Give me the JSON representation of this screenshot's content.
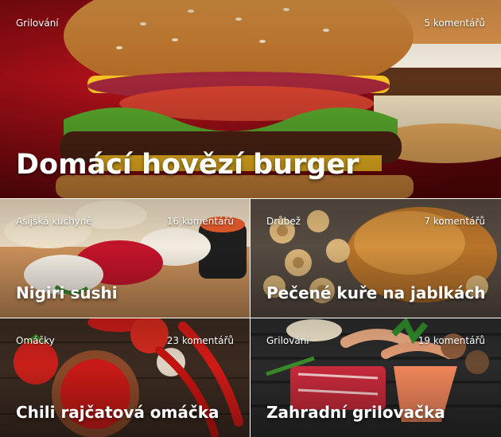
{
  "featured": {
    "category": "Grilování",
    "comments": "5 komentářů",
    "title": "Domácí hovězí burger"
  },
  "articles": [
    {
      "category": "Asijská kuchyně",
      "comments": "16 komentářů",
      "title": "Nigiri sushi"
    },
    {
      "category": "Drůbež",
      "comments": "7 komentářů",
      "title": "Pečené kuře na jablkách"
    },
    {
      "category": "Omáčky",
      "comments": "23 komentářů",
      "title": "Chili rajčatová omáčka"
    },
    {
      "category": "Grilování",
      "comments": "19 komentářů",
      "title": "Zahradní grilovačka"
    }
  ]
}
